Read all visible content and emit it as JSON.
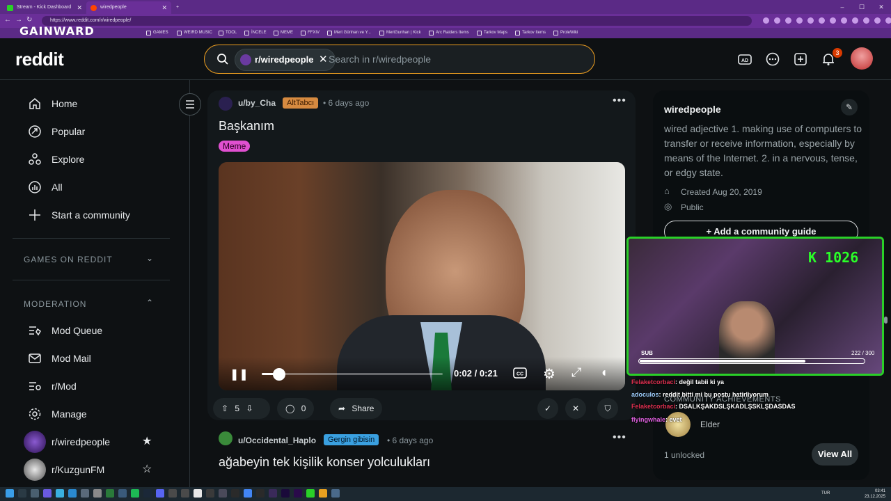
{
  "browser": {
    "tabs": [
      {
        "title": "Stream - Kick Dashboard",
        "fav": "#2ad028"
      },
      {
        "title": "wiredpeople",
        "fav": "#ff4500"
      }
    ],
    "url": "https://www.reddit.com/r/wiredpeople/",
    "bookmarks": [
      "GAMES",
      "WEIRD MUSIC",
      "TOOL",
      "İNCELE",
      "MEME",
      "FFXIV",
      "Mert Günhan ve Y...",
      "MertGunhan | Kick",
      "Arc Raiders Items",
      "Tarkov Maps",
      "Tarkov Items",
      "ProleWiki"
    ]
  },
  "overlay_brand": "GAINWARD",
  "header": {
    "logo": "reddit",
    "search_chip": "r/wiredpeople",
    "search_placeholder": "Search in r/wiredpeople",
    "notification_count": "3"
  },
  "sidebar": {
    "nav": [
      "Home",
      "Popular",
      "Explore",
      "All",
      "Start a community"
    ],
    "games_section": "GAMES ON REDDIT",
    "moderation_section": "MODERATION",
    "moderation": [
      "Mod Queue",
      "Mod Mail",
      "r/Mod",
      "Manage"
    ],
    "communities": [
      "r/wiredpeople",
      "r/KuzgunFM"
    ]
  },
  "post": {
    "user": "u/by_Cha",
    "flair": "AltTabcı",
    "time": "• 6 days ago",
    "title": "Başkanım",
    "tag": "Meme",
    "video_time": "0:02 / 0:21",
    "video_progress": 0.095,
    "score": "5",
    "comments": "0",
    "share": "Share"
  },
  "post2": {
    "user": "u/Occidental_Haplo",
    "flair": "Gergin gibisin",
    "time": "• 6 days ago",
    "title": "ağabeyin tek kişilik konser yolculukları"
  },
  "community": {
    "name": "wiredpeople",
    "description": "wired adjective 1. making use of computers to transfer or receive information, especially by means of the Internet. 2. in a nervous, tense, or edgy state.",
    "created": "Created Aug 20, 2019",
    "visibility": "Public",
    "guide_button": "Add a community guide",
    "achievements_title": "COMMUNITY ACHIEVEMENTS",
    "achievement": "Elder",
    "unlocked": "1 unlocked",
    "view_all": "View All"
  },
  "stream": {
    "kick_counter": "K 1026",
    "sub_label": "SUB",
    "sub_count": "222 / 300",
    "sub_progress": 0.74,
    "chat": [
      {
        "name": "Felaketcorbaci",
        "msg": ": değil tabii ki ya"
      },
      {
        "name": "adoculos",
        "msg": ": reddit bitti mi bu postu hatirliyorum"
      },
      {
        "name": "Felaketcorbaci",
        "msg": ": DSALKŞAKDSLŞKADLŞSKLŞDASDAS"
      },
      {
        "name": "flyingwhale",
        "msg": ": evet"
      }
    ]
  },
  "taskbar": {
    "lang": "TUR",
    "time": "03:41",
    "date": "23.12.2025"
  }
}
